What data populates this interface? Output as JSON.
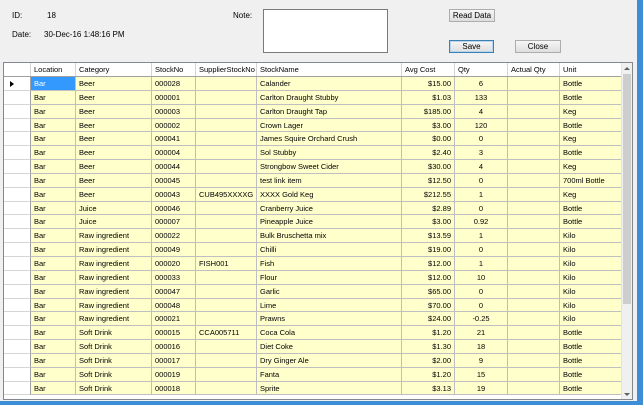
{
  "form": {
    "id_label": "ID:",
    "id_value": "18",
    "date_label": "Date:",
    "date_value": "30-Dec-16 1:48:16 PM",
    "note_label": "Note:",
    "note_value": ""
  },
  "buttons": {
    "read_data": "Read Data",
    "save": "Save",
    "close": "Close"
  },
  "grid": {
    "columns": [
      "Location",
      "Category",
      "StockNo",
      "SupplierStockNo",
      "StockName",
      "Avg Cost",
      "Qty",
      "Actual Qty",
      "Unit"
    ],
    "rows": [
      [
        "Bar",
        "Beer",
        "000028",
        "",
        "Calander",
        "$15.00",
        "6",
        "",
        "Bottle"
      ],
      [
        "Bar",
        "Beer",
        "000001",
        "",
        "Carlton Draught Stubby",
        "$1.03",
        "133",
        "",
        "Bottle"
      ],
      [
        "Bar",
        "Beer",
        "000003",
        "",
        "Carlton Draught Tap",
        "$185.00",
        "4",
        "",
        "Keg"
      ],
      [
        "Bar",
        "Beer",
        "000002",
        "",
        "Crown Lager",
        "$3.00",
        "120",
        "",
        "Bottle"
      ],
      [
        "Bar",
        "Beer",
        "000041",
        "",
        "James Squire Orchard Crush",
        "$0.00",
        "0",
        "",
        "Keg"
      ],
      [
        "Bar",
        "Beer",
        "000004",
        "",
        "Sol Stubby",
        "$2.40",
        "3",
        "",
        "Bottle"
      ],
      [
        "Bar",
        "Beer",
        "000044",
        "",
        "Strongbow Sweet Cider",
        "$30.00",
        "4",
        "",
        "Keg"
      ],
      [
        "Bar",
        "Beer",
        "000045",
        "",
        "test link item",
        "$12.50",
        "0",
        "",
        "700ml Bottle"
      ],
      [
        "Bar",
        "Beer",
        "000043",
        "CUB495XXXXG",
        "XXXX Gold Keg",
        "$212.55",
        "1",
        "",
        "Keg"
      ],
      [
        "Bar",
        "Juice",
        "000046",
        "",
        "Cranberry Juice",
        "$2.89",
        "0",
        "",
        "Bottle"
      ],
      [
        "Bar",
        "Juice",
        "000007",
        "",
        "Pineapple Juice",
        "$3.00",
        "0.92",
        "",
        "Bottle"
      ],
      [
        "Bar",
        "Raw ingredient",
        "000022",
        "",
        "Bulk Bruschetta mix",
        "$13.59",
        "1",
        "",
        "Kilo"
      ],
      [
        "Bar",
        "Raw ingredient",
        "000049",
        "",
        "Chilli",
        "$19.00",
        "0",
        "",
        "Kilo"
      ],
      [
        "Bar",
        "Raw ingredient",
        "000020",
        "FISH001",
        "Fish",
        "$12.00",
        "1",
        "",
        "Kilo"
      ],
      [
        "Bar",
        "Raw ingredient",
        "000033",
        "",
        "Flour",
        "$12.00",
        "10",
        "",
        "Kilo"
      ],
      [
        "Bar",
        "Raw ingredient",
        "000047",
        "",
        "Garlic",
        "$65.00",
        "0",
        "",
        "Kilo"
      ],
      [
        "Bar",
        "Raw ingredient",
        "000048",
        "",
        "Lime",
        "$70.00",
        "0",
        "",
        "Kilo"
      ],
      [
        "Bar",
        "Raw ingredient",
        "000021",
        "",
        "Prawns",
        "$24.00",
        "-0.25",
        "",
        "Kilo"
      ],
      [
        "Bar",
        "Soft Drink",
        "000015",
        "CCA005711",
        "Coca Cola",
        "$1.20",
        "21",
        "",
        "Bottle"
      ],
      [
        "Bar",
        "Soft Drink",
        "000016",
        "",
        "Diet Coke",
        "$1.30",
        "18",
        "",
        "Bottle"
      ],
      [
        "Bar",
        "Soft Drink",
        "000017",
        "",
        "Dry Ginger Ale",
        "$2.00",
        "9",
        "",
        "Bottle"
      ],
      [
        "Bar",
        "Soft Drink",
        "000019",
        "",
        "Fanta",
        "$1.20",
        "15",
        "",
        "Bottle"
      ],
      [
        "Bar",
        "Soft Drink",
        "000018",
        "",
        "Sprite",
        "$3.13",
        "19",
        "",
        "Bottle"
      ]
    ]
  },
  "colors": {
    "cell_bg": "#ffffcc",
    "selected_bg": "#3399ff",
    "window_border": "#3c8fd6"
  }
}
